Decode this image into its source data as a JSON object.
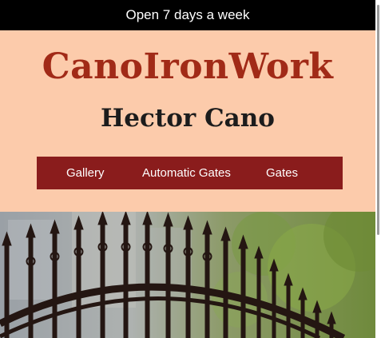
{
  "announcement": "Open 7 days a week",
  "brand": {
    "name": "CanoIronWork",
    "owner": "Hector Cano"
  },
  "nav": {
    "items": [
      {
        "label": "Gallery"
      },
      {
        "label": "Automatic Gates"
      },
      {
        "label": "Gates"
      }
    ]
  },
  "colors": {
    "topbar": "#000000",
    "header_bg": "#fccbab",
    "brand_text": "#a12a17",
    "nav_bg": "#8a1c1c"
  },
  "hero": {
    "image": "wrought-iron-gate-photo"
  }
}
